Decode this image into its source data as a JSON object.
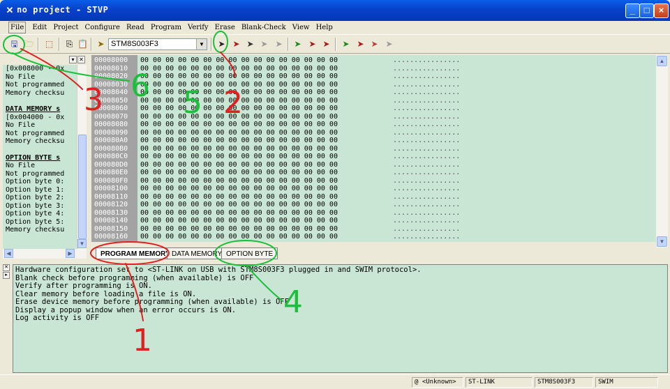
{
  "window": {
    "title": "no project - STVP",
    "minimize": "_",
    "maximize": "□",
    "close": "×"
  },
  "menu": [
    "File",
    "Edit",
    "Project",
    "Configure",
    "Read",
    "Program",
    "Verify",
    "Erase",
    "Blank-Check",
    "View",
    "Help"
  ],
  "toolbar": {
    "device": "STM8S003F3"
  },
  "left_panel": {
    "lines": [
      {
        "t": "[0x008000 - 0x",
        "sec": false
      },
      {
        "t": "No File",
        "sec": false
      },
      {
        "t": "Not programmed",
        "sec": false
      },
      {
        "t": "Memory checksu",
        "sec": false
      },
      {
        "t": "DATA MEMORY s",
        "sec": true
      },
      {
        "t": "[0x004000 - 0x",
        "sec": false
      },
      {
        "t": "No File",
        "sec": false
      },
      {
        "t": "Not programmed",
        "sec": false
      },
      {
        "t": "Memory checksu",
        "sec": false
      },
      {
        "t": "OPTION BYTE s",
        "sec": true
      },
      {
        "t": "No File",
        "sec": false
      },
      {
        "t": "Not programmed",
        "sec": false
      },
      {
        "t": "Option byte 0:",
        "sec": false
      },
      {
        "t": "Option byte 1:",
        "sec": false
      },
      {
        "t": "Option byte 2:",
        "sec": false
      },
      {
        "t": "Option byte 3:",
        "sec": false
      },
      {
        "t": "Option byte 4:",
        "sec": false
      },
      {
        "t": "Option byte 5:",
        "sec": false
      },
      {
        "t": "Memory checksu",
        "sec": false
      }
    ]
  },
  "hex": {
    "addresses": [
      "00008000",
      "00008010",
      "00008020",
      "00008030",
      "00008040",
      "00008050",
      "00008060",
      "00008070",
      "00008080",
      "00008090",
      "000080A0",
      "000080B0",
      "000080C0",
      "000080D0",
      "000080E0",
      "000080F0",
      "00008100",
      "00008110",
      "00008120",
      "00008130",
      "00008140",
      "00008150",
      "00008160"
    ],
    "bytes": "00 00 00 00 00 00 00 00 00 00 00 00 00 00 00 00",
    "ascii": "................"
  },
  "tabs": [
    "PROGRAM MEMORY",
    "DATA MEMORY",
    "OPTION BYTE"
  ],
  "log": [
    "Hardware configuration set to <ST-LINK on USB with STM8S003F3 plugged in and SWIM protocol>.",
    "Blank check before programming (when available) is OFF",
    "Verify after programming is ON.",
    "Clear memory before loading a file is ON.",
    "Erase device memory before programming (when available) is OFF",
    "Display a popup window when an error occurs is ON.",
    "Log activity is OFF"
  ],
  "status": [
    "@ <Unknown>",
    "ST-LINK",
    "STM8S003F3",
    "SWIM"
  ],
  "annotations": [
    "1",
    "2",
    "3",
    "4",
    "5",
    "6"
  ]
}
